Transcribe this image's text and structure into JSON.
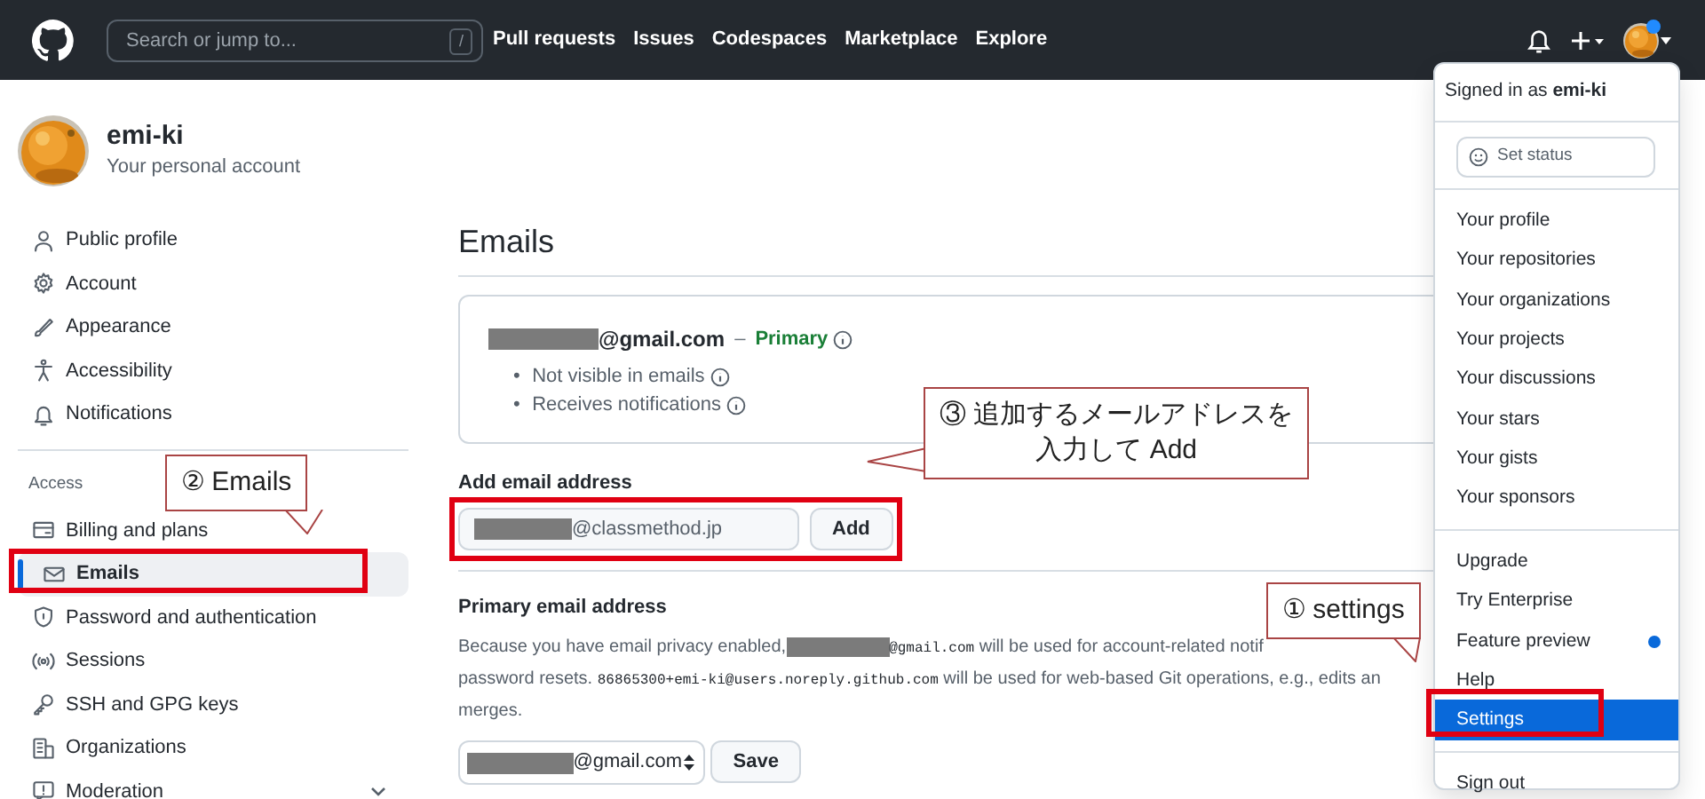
{
  "navbar": {
    "search": {
      "placeholder": "Search or jump to...",
      "shortcut": "/"
    },
    "links": [
      "Pull requests",
      "Issues",
      "Codespaces",
      "Marketplace",
      "Explore"
    ],
    "avatar_dot": true
  },
  "profile": {
    "name": "emi-ki",
    "subtitle": "Your personal account"
  },
  "sidebar": {
    "items": [
      {
        "label": "Public profile",
        "selected": false
      },
      {
        "label": "Account",
        "selected": false
      },
      {
        "label": "Appearance",
        "selected": false
      },
      {
        "label": "Accessibility",
        "selected": false
      },
      {
        "label": "Notifications",
        "selected": false
      }
    ],
    "section": {
      "heading": "Access",
      "items": [
        {
          "label": "Billing and plans",
          "selected": false
        },
        {
          "label": "Emails",
          "selected": true
        },
        {
          "label": "Password and authentication",
          "selected": false
        },
        {
          "label": "Sessions",
          "selected": false
        },
        {
          "label": "SSH and GPG keys",
          "selected": false
        },
        {
          "label": "Organizations",
          "selected": false
        },
        {
          "label": "Moderation",
          "selected": false,
          "expanded": false
        }
      ]
    }
  },
  "main": {
    "title": "Emails",
    "primary_email": {
      "email": {
        "redacted": true,
        "domain": "@gmail.com"
      },
      "separator": "–",
      "badge": "Primary",
      "notes": [
        {
          "bullet": "•",
          "text": "Not visible in emails"
        },
        {
          "bullet": "•",
          "text": "Receives notifications"
        }
      ]
    },
    "add_email": {
      "label": "Add email address",
      "value": {
        "redacted": true,
        "domain": "@classmethod.jp"
      },
      "button": "Add"
    },
    "primary_section": {
      "label": "Primary email address",
      "lines": [
        [
          {
            "kind": "text",
            "text": "Because you have email privacy enabled,"
          },
          {
            "kind": "redacted"
          },
          {
            "kind": "code",
            "text": "@gmail.com"
          },
          {
            "kind": "text",
            "text": " will be used for account-related notif"
          }
        ],
        [
          {
            "kind": "text",
            "text": "password resets. "
          },
          {
            "kind": "code",
            "text": "86865300+emi-ki@users.noreply.github.com"
          },
          {
            "kind": "text",
            "text": " will be used for web-based Git operations, e.g., edits an"
          }
        ],
        [
          {
            "kind": "text",
            "text": "merges."
          }
        ]
      ],
      "select": {
        "redacted": true,
        "domain": "@gmail.com"
      },
      "button": "Save"
    }
  },
  "menu": {
    "signed_in_prefix": "Signed in as",
    "username": "emi-ki",
    "status_button": "Set status",
    "groups": [
      [
        {
          "label": "Your profile",
          "selected": false
        },
        {
          "label": "Your repositories",
          "selected": false
        },
        {
          "label": "Your organizations",
          "selected": false
        },
        {
          "label": "Your projects",
          "selected": false
        },
        {
          "label": "Your discussions",
          "selected": false
        },
        {
          "label": "Your stars",
          "selected": false
        },
        {
          "label": "Your gists",
          "selected": false
        },
        {
          "label": "Your sponsors",
          "selected": false
        }
      ],
      [
        {
          "label": "Upgrade",
          "selected": false,
          "dot": false
        },
        {
          "label": "Try Enterprise",
          "selected": false,
          "dot": false
        },
        {
          "label": "Feature preview",
          "selected": false,
          "dot": true
        },
        {
          "label": "Help",
          "selected": false,
          "dot": false
        },
        {
          "label": "Settings",
          "selected": true,
          "dot": false
        }
      ],
      [
        {
          "label": "Sign out",
          "selected": false
        }
      ]
    ]
  },
  "callouts": [
    {
      "lines": [
        "② Emails"
      ],
      "highlight": true
    },
    {
      "lines": [
        "③ 追加するメールアドレスを",
        "入力して Add"
      ],
      "highlight": true
    },
    {
      "lines": [
        "① settings"
      ],
      "highlight": true
    }
  ]
}
